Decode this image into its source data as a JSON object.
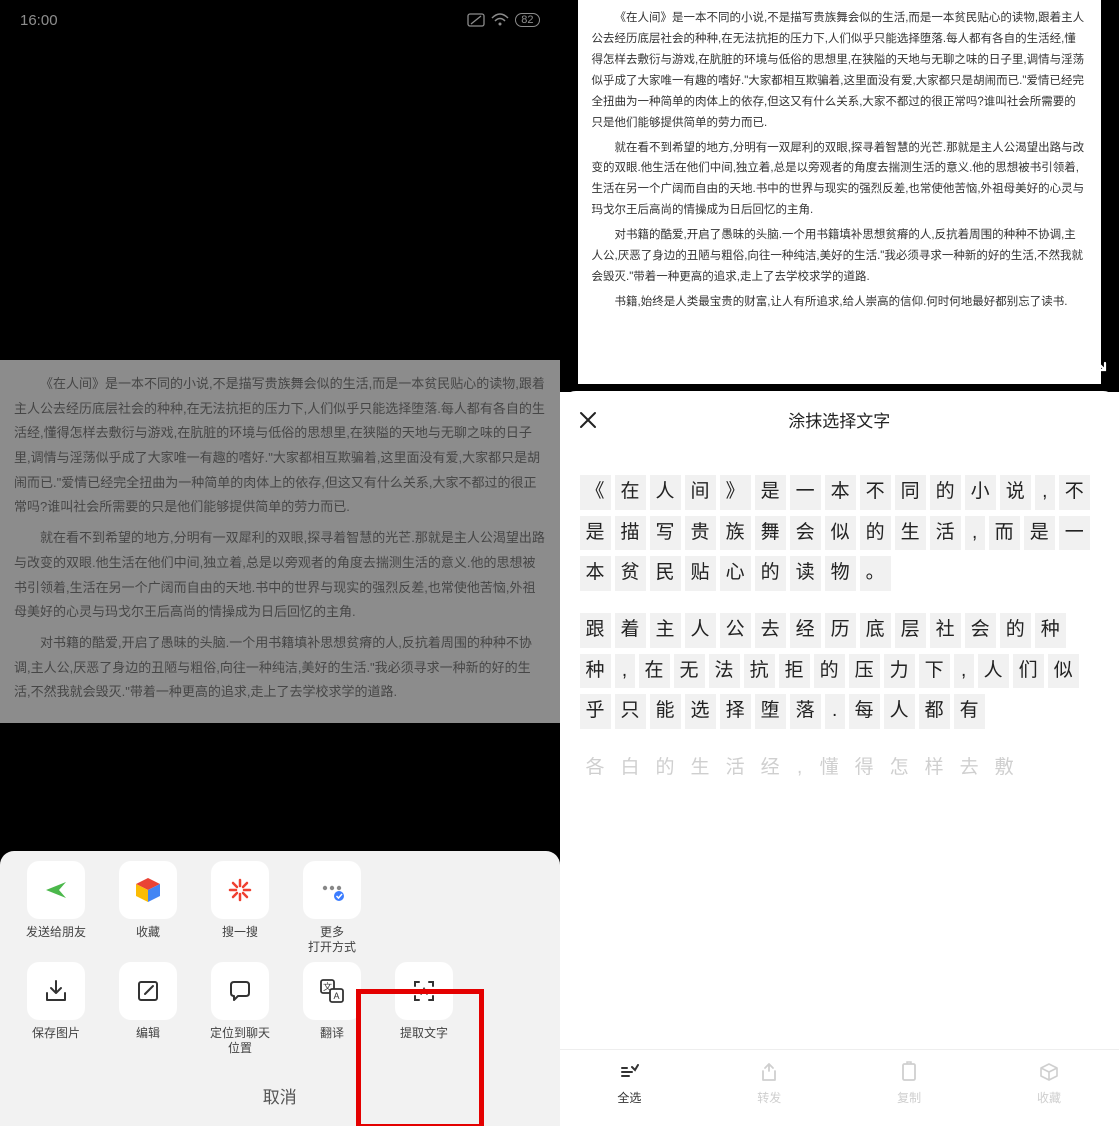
{
  "status": {
    "time": "16:00",
    "battery": "82"
  },
  "article_left": {
    "p1": "《在人间》是一本不同的小说,不是描写贵族舞会似的生活,而是一本贫民贴心的读物,跟着主人公去经历底层社会的种种,在无法抗拒的压力下,人们似乎只能选择堕落.每人都有各自的生活经,懂得怎样去敷衍与游戏,在肮脏的环境与低俗的思想里,在狭隘的天地与无聊之味的日子里,调情与淫荡似乎成了大家唯一有趣的嗜好.\"大家都相互欺骗着,这里面没有爱,大家都只是胡闹而已.\"爱情已经完全扭曲为一种简单的肉体上的依存,但这又有什么关系,大家不都过的很正常吗?谁叫社会所需要的只是他们能够提供简单的劳力而已.",
    "p2": "就在看不到希望的地方,分明有一双犀利的双眼,探寻着智慧的光芒.那就是主人公渴望出路与改变的双眼.他生活在他们中间,独立着,总是以旁观者的角度去揣测生活的意义.他的思想被书引领着,生活在另一个广阔而自由的天地.书中的世界与现实的强烈反差,也常使他苦恼,外祖母美好的心灵与玛戈尔王后高尚的情操成为日后回忆的主角.",
    "p3": "对书籍的酷爱,开启了愚昧的头脑.一个用书籍填补思想贫瘠的人,反抗着周围的种种不协调,主人公,厌恶了身边的丑陋与粗俗,向往一种纯洁,美好的生活.\"我必须寻求一种新的好的生活,不然我就会毁灭.\"带着一种更高的追求,走上了去学校求学的道路."
  },
  "article_right": {
    "p1": "《在人间》是一本不同的小说,不是描写贵族舞会似的生活,而是一本贫民贴心的读物,跟着主人公去经历底层社会的种种,在无法抗拒的压力下,人们似乎只能选择堕落.每人都有各自的生活经,懂得怎样去敷衍与游戏,在肮脏的环境与低俗的思想里,在狭隘的天地与无聊之味的日子里,调情与淫荡似乎成了大家唯一有趣的嗜好.\"大家都相互欺骗着,这里面没有爱,大家都只是胡闹而已.\"爱情已经完全扭曲为一种简单的肉体上的依存,但这又有什么关系,大家不都过的很正常吗?谁叫社会所需要的只是他们能够提供简单的劳力而已.",
    "p2": "就在看不到希望的地方,分明有一双犀利的双眼,探寻着智慧的光芒.那就是主人公渴望出路与改变的双眼.他生活在他们中间,独立着,总是以旁观者的角度去揣测生活的意义.他的思想被书引领着,生活在另一个广阔而自由的天地.书中的世界与现实的强烈反差,也常使他苦恼,外祖母美好的心灵与玛戈尔王后高尚的情操成为日后回忆的主角.",
    "p3": "对书籍的酷爱,开启了愚昧的头脑.一个用书籍填补思想贫瘠的人,反抗着周围的种种不协调,主人公,厌恶了身边的丑陋与粗俗,向往一种纯洁,美好的生活.\"我必须寻求一种新的好的生活,不然我就会毁灭.\"带着一种更高的追求,走上了去学校求学的道路.",
    "p4": "书籍,始终是人类最宝贵的财富,让人有所追求,给人崇高的信仰.何时何地最好都别忘了读书."
  },
  "share": {
    "row1": [
      {
        "label": "发送给朋友",
        "icon": "share-arrow-icon"
      },
      {
        "label": "收藏",
        "icon": "favorite-cube-icon"
      },
      {
        "label": "搜一搜",
        "icon": "search-spark-icon"
      },
      {
        "label": "更多\n打开方式",
        "icon": "more-apps-icon"
      }
    ],
    "row2": [
      {
        "label": "保存图片",
        "icon": "download-icon"
      },
      {
        "label": "编辑",
        "icon": "edit-icon"
      },
      {
        "label": "定位到聊天\n位置",
        "icon": "chat-locate-icon"
      },
      {
        "label": "翻译",
        "icon": "translate-icon"
      },
      {
        "label": "提取文字",
        "icon": "extract-text-icon"
      }
    ],
    "cancel": "取消"
  },
  "extract": {
    "title": "涂抹选择文字",
    "para1": "《在人间》是一本不同的小说,不是描写贵族舞会似的生活,而是一本贫民贴心的读物。",
    "para2": "跟着主人公去经历底层社会的种种,在无法抗拒的压力下,人们似乎只能选择堕落.每人都有",
    "para3_faded": "各白的生活经,懂得怎样去敷",
    "bottom": [
      {
        "label": "全选",
        "icon": "select-all-icon",
        "active": true
      },
      {
        "label": "转发",
        "icon": "forward-icon",
        "active": false
      },
      {
        "label": "复制",
        "icon": "copy-icon",
        "active": false
      },
      {
        "label": "收藏",
        "icon": "save-cube-icon",
        "active": false
      }
    ]
  }
}
